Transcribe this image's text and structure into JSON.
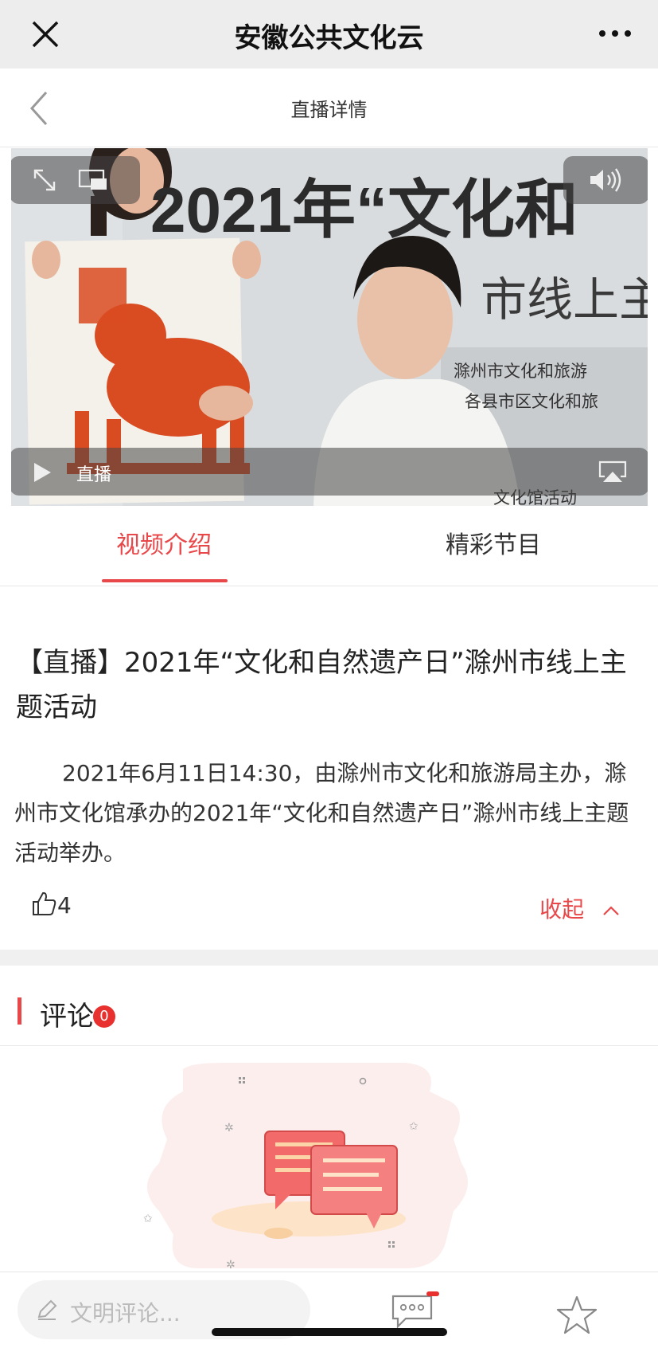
{
  "topbar": {
    "title": "安徽公共文化云"
  },
  "navbar": {
    "title": "直播详情"
  },
  "video": {
    "status_label": "直播",
    "backdrop_text": {
      "year_title": "2021年“文化和",
      "subtitle": "市线上主",
      "line1": "滁州市文化和旅游",
      "line2": "各县市区文化和旅",
      "line3": "文化馆活动"
    }
  },
  "tabs": [
    {
      "label": "视频介绍",
      "active": true
    },
    {
      "label": "精彩节目",
      "active": false
    }
  ],
  "article": {
    "title": "【直播】2021年“文化和自然遗产日”滁州市线上主题活动",
    "description": "2021年6月11日14:30，由滁州市文化和旅游局主办，滁州市文化馆承办的2021年“文化和自然遗产日”滁州市线上主题活动举办。",
    "likes": "4",
    "collapse_label": "收起"
  },
  "comments": {
    "label": "评论",
    "count": "0"
  },
  "bottom": {
    "comment_placeholder": "文明评论..."
  },
  "colors": {
    "accent": "#e8484a",
    "badge": "#e8302e"
  },
  "icons": [
    "close-icon",
    "more-icon",
    "back-icon",
    "fullscreen-icon",
    "pip-icon",
    "volume-icon",
    "play-icon",
    "airplay-icon",
    "like-icon",
    "chevron-up-icon",
    "pen-icon",
    "message-icon",
    "star-icon"
  ]
}
